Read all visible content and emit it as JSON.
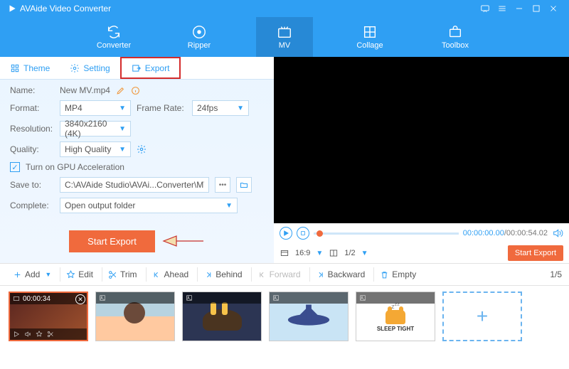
{
  "app": {
    "title": "AVAide Video Converter"
  },
  "nav": {
    "converter": "Converter",
    "ripper": "Ripper",
    "mv": "MV",
    "collage": "Collage",
    "toolbox": "Toolbox"
  },
  "tabs": {
    "theme": "Theme",
    "setting": "Setting",
    "export": "Export"
  },
  "form": {
    "name_label": "Name:",
    "name_value": "New MV.mp4",
    "format_label": "Format:",
    "format_value": "MP4",
    "framerate_label": "Frame Rate:",
    "framerate_value": "24fps",
    "resolution_label": "Resolution:",
    "resolution_value": "3840x2160 (4K)",
    "quality_label": "Quality:",
    "quality_value": "High Quality",
    "gpu_label": "Turn on GPU Acceleration",
    "saveto_label": "Save to:",
    "saveto_value": "C:\\AVAide Studio\\AVAi...Converter\\MV Exported",
    "complete_label": "Complete:",
    "complete_value": "Open output folder",
    "start_btn": "Start Export"
  },
  "player": {
    "time_current": "00:00:00.00",
    "time_total": "/00:00:54.02",
    "ratio": "16:9",
    "page": "1/2",
    "start_export": "Start Export"
  },
  "toolbar": {
    "add": "Add",
    "edit": "Edit",
    "trim": "Trim",
    "ahead": "Ahead",
    "behind": "Behind",
    "forward": "Forward",
    "backward": "Backward",
    "empty": "Empty",
    "counter": "1/5"
  },
  "thumbs": {
    "t1_duration": "00:00:34",
    "sleep": "SLEEP TIGHT"
  }
}
